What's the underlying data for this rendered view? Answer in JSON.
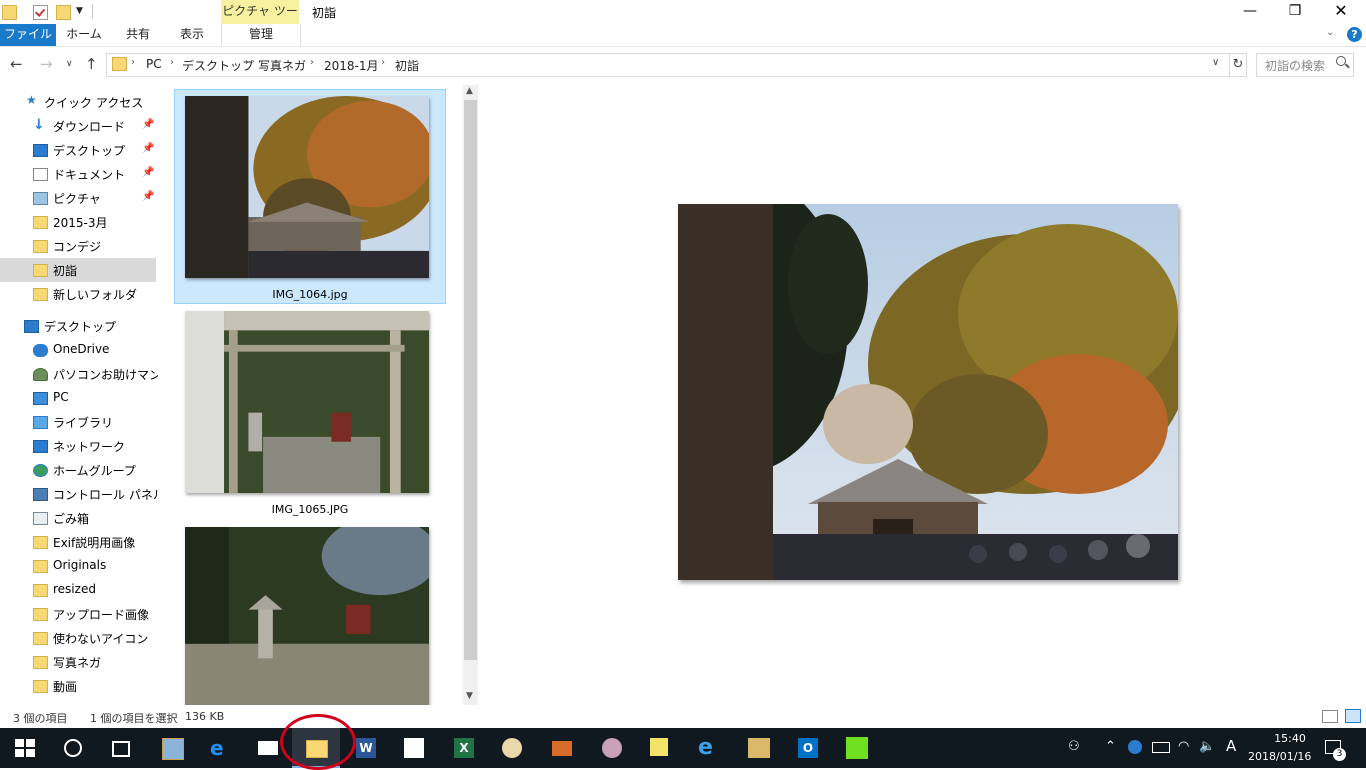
{
  "window": {
    "context_tab_header": "ピクチャ ツール",
    "title": "初詣",
    "minimize_glyph": "—",
    "maximize_glyph": "❐",
    "close_glyph": "✕"
  },
  "ribbon": {
    "tabs": [
      "ファイル",
      "ホーム",
      "共有",
      "表示",
      "管理"
    ],
    "help_glyph": "?"
  },
  "address": {
    "breadcrumbs": [
      "PC",
      "デスクトップ",
      "写真ネガ",
      "2018-1月",
      "初詣"
    ],
    "search_placeholder": "初詣の検索"
  },
  "nav": {
    "quick_access": "クイック アクセス",
    "items": [
      {
        "label": "ダウンロード",
        "icon": "download-icon",
        "pinned": true
      },
      {
        "label": "デスクトップ",
        "icon": "desktop-icon",
        "pinned": true
      },
      {
        "label": "ドキュメント",
        "icon": "document-icon",
        "pinned": true
      },
      {
        "label": "ピクチャ",
        "icon": "pictures-icon",
        "pinned": true
      },
      {
        "label": "2015-3月",
        "icon": "folder-icon"
      },
      {
        "label": "コンデジ",
        "icon": "folder-icon"
      },
      {
        "label": "初詣",
        "icon": "folder-icon",
        "selected": true
      },
      {
        "label": "新しいフォルダ",
        "icon": "folder-icon"
      }
    ],
    "desktop_root": "デスクトップ",
    "desktop_items": [
      {
        "label": "OneDrive",
        "icon": "onedrive-icon"
      },
      {
        "label": "パソコンお助けマン",
        "icon": "user-icon"
      },
      {
        "label": "PC",
        "icon": "pc-icon"
      },
      {
        "label": "ライブラリ",
        "icon": "library-icon"
      },
      {
        "label": "ネットワーク",
        "icon": "network-icon"
      },
      {
        "label": "ホームグループ",
        "icon": "homegroup-icon"
      },
      {
        "label": "コントロール パネル",
        "icon": "control-panel-icon"
      },
      {
        "label": "ごみ箱",
        "icon": "recycle-bin-icon"
      },
      {
        "label": "Exif説明用画像",
        "icon": "folder-icon"
      },
      {
        "label": "Originals",
        "icon": "folder-icon"
      },
      {
        "label": "resized",
        "icon": "folder-icon"
      },
      {
        "label": "アップロード画像",
        "icon": "folder-icon"
      },
      {
        "label": "使わないアイコン",
        "icon": "folder-icon"
      },
      {
        "label": "写真ネガ",
        "icon": "folder-icon"
      },
      {
        "label": "動画",
        "icon": "folder-icon"
      }
    ]
  },
  "files": [
    {
      "name": "IMG_1064.jpg",
      "selected": true
    },
    {
      "name": "IMG_1065.JPG",
      "selected": false
    },
    {
      "name": "",
      "selected": false
    }
  ],
  "status": {
    "count": "3 個の項目",
    "selection": "1 個の項目を選択",
    "size": "136 KB"
  },
  "taskbar": {
    "apps": [
      "start-icon",
      "cortana-icon",
      "task-view-icon",
      "photo-viewer-icon",
      "edge-icon",
      "mail-icon",
      "file-explorer-icon",
      "word-icon",
      "store-icon",
      "excel-icon",
      "paint-icon",
      "toolbox-icon",
      "paint-palette-icon",
      "sticky-notes-icon",
      "internet-explorer-icon",
      "notepad-icon",
      "outlook-icon",
      "green-app-icon"
    ],
    "ime_indicator": "A",
    "time": "15:40",
    "date": "2018/01/16",
    "notification_count": "3"
  },
  "colors": {
    "accent": "#1979ca",
    "context_tab": "#f8f1a0",
    "selection": "#cce8ff",
    "taskbar": "#101820",
    "highlight_circle": "#d0021b"
  }
}
